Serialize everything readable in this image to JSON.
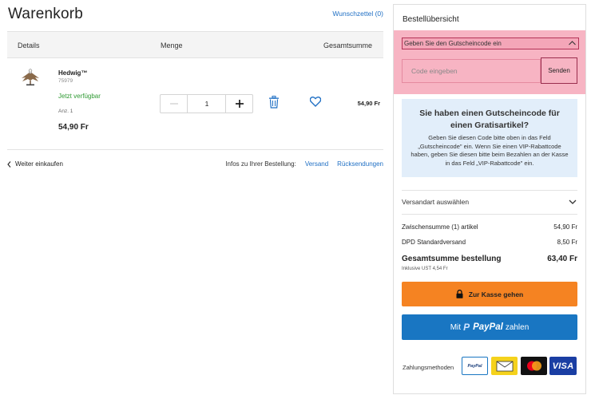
{
  "header": {
    "title": "Warenkorb",
    "wishlist_link": "Wunschzettel (0)"
  },
  "table_head": {
    "details": "Details",
    "quantity": "Menge",
    "total": "Gesamtsumme"
  },
  "product": {
    "name": "Hedwig™",
    "sku": "75979",
    "stock": "Jetzt verfügbar",
    "qty_text": "Anz. 1",
    "price": "54,90 Fr",
    "quantity": "1",
    "row_total": "54,90 Fr"
  },
  "footer_links": {
    "continue": "Weiter einkaufen",
    "info_label": "Infos zu Ihrer Bestellung:",
    "shipping": "Versand",
    "returns": "Rücksendungen"
  },
  "summary": {
    "title": "Bestellübersicht",
    "coupon_toggle": "Geben Sie den Gutscheincode ein",
    "coupon_placeholder": "Code eingeben",
    "coupon_submit": "Senden",
    "free_title": "Sie haben einen Gutscheincode für einen Gratisartikel?",
    "free_body": "Geben Sie diesen Code bitte oben in das Feld „Gutscheincode\" ein. Wenn Sie einen VIP-Rabattcode haben, geben Sie diesen bitte beim Bezahlen an der Kasse in das Feld „VIP-Rabattcode\" ein.",
    "shipping_select": "Versandart auswählen",
    "subtotal_label": "Zwischensumme (1) artikel",
    "subtotal_value": "54,90 Fr",
    "shipping_label": "DPD Standardversand",
    "shipping_value": "8,50 Fr",
    "grand_label": "Gesamtsumme bestellung",
    "grand_value": "63,40 Fr",
    "vat_note": "Inklusive UST 4,54 Fr",
    "checkout_label": "Zur Kasse gehen",
    "paypal_prefix": "Mit",
    "paypal_brand": "PayPal",
    "paypal_suffix": "zahlen",
    "payment_methods_label": "Zahlungsmethoden",
    "pm_paypal_text": "PayPal",
    "pm_visa_text": "VISA"
  },
  "colors": {
    "link": "#1f6fc4",
    "in_stock": "#2f9a33",
    "checkout": "#f58322",
    "paypal": "#1976c2",
    "coupon_highlight": "#f7b4c3"
  },
  "icons": {
    "trash": "trash-icon",
    "heart": "heart-icon",
    "lock": "lock-icon",
    "chevron_down": "chevron-down-icon",
    "chevron_up": "chevron-up-icon",
    "chevron_left": "chevron-left-icon"
  }
}
